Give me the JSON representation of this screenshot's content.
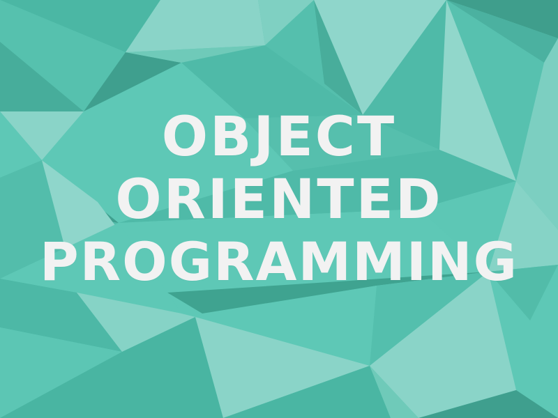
{
  "title": {
    "line1": "OBJECT",
    "line2": "ORIENTED",
    "line3": "PROGRAMMING"
  },
  "colors": {
    "base": "#5ec8b6",
    "dark": "#44a794",
    "mid": "#4fbaa8",
    "light": "#86d3c6",
    "lighter": "#9adacf",
    "text": "#f2f2f2"
  },
  "background": {
    "style": "low-poly triangular mosaic"
  }
}
